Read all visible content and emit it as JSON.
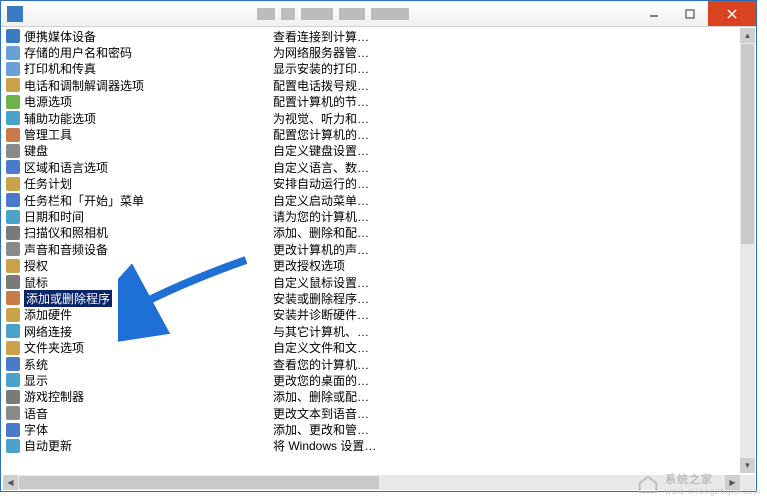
{
  "titlebar": {
    "app_icon_name": "control-panel-icon",
    "min": "—",
    "max": "☐",
    "close": "✕"
  },
  "watermark": {
    "text": "系统之家",
    "url": "www.xitongzhijia.com"
  },
  "items": [
    {
      "name": "便携媒体设备",
      "desc": "查看连接到计算…",
      "icon": "#3a7ac0"
    },
    {
      "name": "存储的用户名和密码",
      "desc": "为网络服务器管…",
      "icon": "#6aa0d8"
    },
    {
      "name": "打印机和传真",
      "desc": "显示安装的打印…",
      "icon": "#6aa0d8"
    },
    {
      "name": "电话和调制解调器选项",
      "desc": "配置电话拨号规…",
      "icon": "#c9a24a"
    },
    {
      "name": "电源选项",
      "desc": "配置计算机的节…",
      "icon": "#6db24a"
    },
    {
      "name": "辅助功能选项",
      "desc": "为视觉、听力和…",
      "icon": "#4aa3c9"
    },
    {
      "name": "管理工具",
      "desc": "配置您计算机的…",
      "icon": "#c97a4a"
    },
    {
      "name": "键盘",
      "desc": "自定义键盘设置…",
      "icon": "#8a8a8a"
    },
    {
      "name": "区域和语言选项",
      "desc": "自定义语言、数…",
      "icon": "#4a7ac9"
    },
    {
      "name": "任务计划",
      "desc": "安排自动运行的…",
      "icon": "#c9a24a"
    },
    {
      "name": "任务栏和「开始」菜单",
      "desc": "自定义启动菜单…",
      "icon": "#4a7ac9"
    },
    {
      "name": "日期和时间",
      "desc": "请为您的计算机…",
      "icon": "#4aa3c9"
    },
    {
      "name": "扫描仪和照相机",
      "desc": "添加、删除和配…",
      "icon": "#7a7a7a"
    },
    {
      "name": "声音和音频设备",
      "desc": "更改计算机的声…",
      "icon": "#8a8a8a"
    },
    {
      "name": "授权",
      "desc": "更改授权选项",
      "icon": "#c9a24a"
    },
    {
      "name": "鼠标",
      "desc": "自定义鼠标设置…",
      "icon": "#7a7a7a"
    },
    {
      "name": "添加或删除程序",
      "desc": "安装或删除程序…",
      "icon": "#c97a4a",
      "selected": true
    },
    {
      "name": "添加硬件",
      "desc": "安装并诊断硬件…",
      "icon": "#c9a24a"
    },
    {
      "name": "网络连接",
      "desc": "与其它计算机、…",
      "icon": "#4aa3c9"
    },
    {
      "name": "文件夹选项",
      "desc": "自定义文件和文…",
      "icon": "#c9a24a"
    },
    {
      "name": "系统",
      "desc": "查看您的计算机…",
      "icon": "#4a7ac9"
    },
    {
      "name": "显示",
      "desc": "更改您的桌面的…",
      "icon": "#4aa3c9"
    },
    {
      "name": "游戏控制器",
      "desc": "添加、删除或配…",
      "icon": "#7a7a7a"
    },
    {
      "name": "语音",
      "desc": "更改文本到语音…",
      "icon": "#8a8a8a"
    },
    {
      "name": "字体",
      "desc": "添加、更改和管…",
      "icon": "#4a7ac9"
    },
    {
      "name": "自动更新",
      "desc": "将 Windows 设置…",
      "icon": "#4aa3c9"
    }
  ]
}
